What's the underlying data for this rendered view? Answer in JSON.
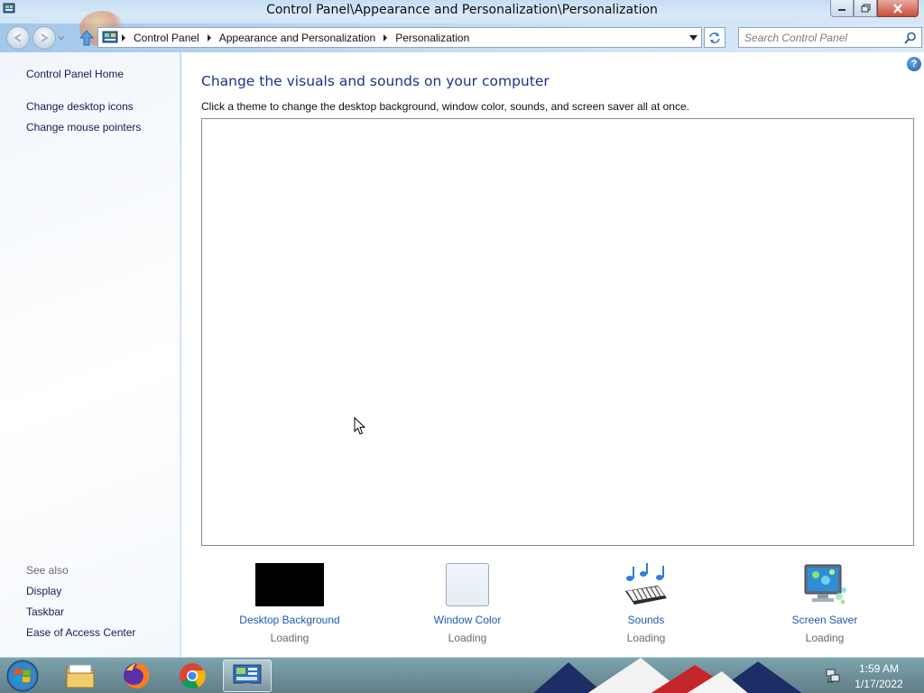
{
  "window": {
    "title": "Control Panel\\Appearance and Personalization\\Personalization"
  },
  "navigation": {
    "breadcrumbs": [
      "Control Panel",
      "Appearance and Personalization",
      "Personalization"
    ],
    "search_placeholder": "Search Control Panel"
  },
  "sidebar": {
    "home_link": "Control Panel Home",
    "links": [
      "Change desktop icons",
      "Change mouse pointers"
    ],
    "see_also_label": "See also",
    "see_also_links": [
      "Display",
      "Taskbar",
      "Ease of Access Center"
    ]
  },
  "main": {
    "heading": "Change the visuals and sounds on your computer",
    "instruction": "Click a theme to change the desktop background, window color, sounds, and screen saver all at once.",
    "settings": [
      {
        "label": "Desktop Background",
        "status": "Loading",
        "icon": "desktop-background-thumbnail"
      },
      {
        "label": "Window Color",
        "status": "Loading",
        "icon": "window-color-thumbnail"
      },
      {
        "label": "Sounds",
        "status": "Loading",
        "icon": "sounds-icon"
      },
      {
        "label": "Screen Saver",
        "status": "Loading",
        "icon": "screen-saver-icon"
      }
    ]
  },
  "taskbar": {
    "apps": [
      "file-explorer-icon",
      "firefox-icon",
      "chrome-icon",
      "control-panel-icon"
    ],
    "clock_time": "1:59 AM",
    "clock_date": "1/17/2022"
  },
  "colors": {
    "link": "#1a5bb0",
    "heading": "#1e3287",
    "close_button": "#c94e3a"
  }
}
